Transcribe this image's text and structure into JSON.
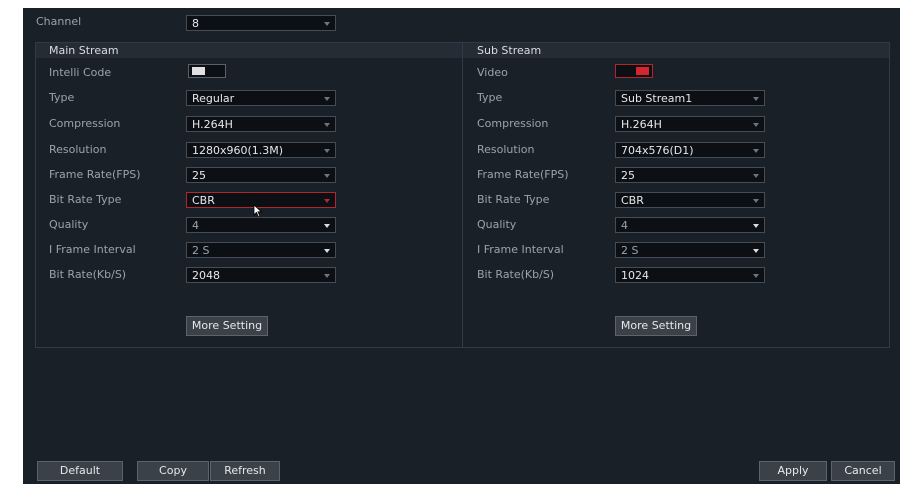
{
  "channel": {
    "label": "Channel",
    "value": "8"
  },
  "main": {
    "title": "Main Stream",
    "intelli_code_label": "Intelli Code",
    "type": {
      "label": "Type",
      "value": "Regular"
    },
    "compression": {
      "label": "Compression",
      "value": "H.264H"
    },
    "resolution": {
      "label": "Resolution",
      "value": "1280x960(1.3M)"
    },
    "frame_rate": {
      "label": "Frame Rate(FPS)",
      "value": "25"
    },
    "bit_rate_type": {
      "label": "Bit Rate Type",
      "value": "CBR"
    },
    "quality": {
      "label": "Quality",
      "value": "4"
    },
    "iframe_interval": {
      "label": "I Frame Interval",
      "value": "2 S"
    },
    "bit_rate": {
      "label": "Bit Rate(Kb/S)",
      "value": "2048"
    },
    "more_setting": "More Setting"
  },
  "sub": {
    "title": "Sub Stream",
    "video_label": "Video",
    "type": {
      "label": "Type",
      "value": "Sub Stream1"
    },
    "compression": {
      "label": "Compression",
      "value": "H.264H"
    },
    "resolution": {
      "label": "Resolution",
      "value": "704x576(D1)"
    },
    "frame_rate": {
      "label": "Frame Rate(FPS)",
      "value": "25"
    },
    "bit_rate_type": {
      "label": "Bit Rate Type",
      "value": "CBR"
    },
    "quality": {
      "label": "Quality",
      "value": "4"
    },
    "iframe_interval": {
      "label": "I Frame Interval",
      "value": "2 S"
    },
    "bit_rate": {
      "label": "Bit Rate(Kb/S)",
      "value": "1024"
    },
    "more_setting": "More Setting"
  },
  "footer": {
    "default": "Default",
    "copy": "Copy",
    "refresh": "Refresh",
    "apply": "Apply",
    "cancel": "Cancel"
  },
  "colors": {
    "panel_bg": "#1a2028",
    "accent_red": "#b3262e",
    "toggle_off": "#e0e0e0"
  }
}
